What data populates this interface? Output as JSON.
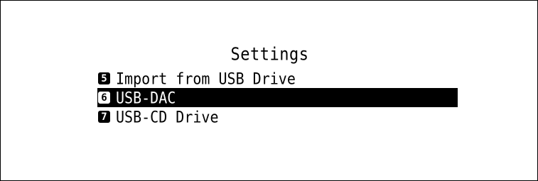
{
  "screen": {
    "title": "Settings"
  },
  "menu": {
    "items": [
      {
        "number": "5",
        "label": "Import from USB Drive",
        "selected": false
      },
      {
        "number": "6",
        "label": "USB-DAC",
        "selected": true
      },
      {
        "number": "7",
        "label": "USB-CD Drive",
        "selected": false
      }
    ]
  },
  "colors": {
    "background": "#ffffff",
    "foreground": "#000000",
    "selection_background": "#000000",
    "selection_foreground": "#ffffff"
  }
}
